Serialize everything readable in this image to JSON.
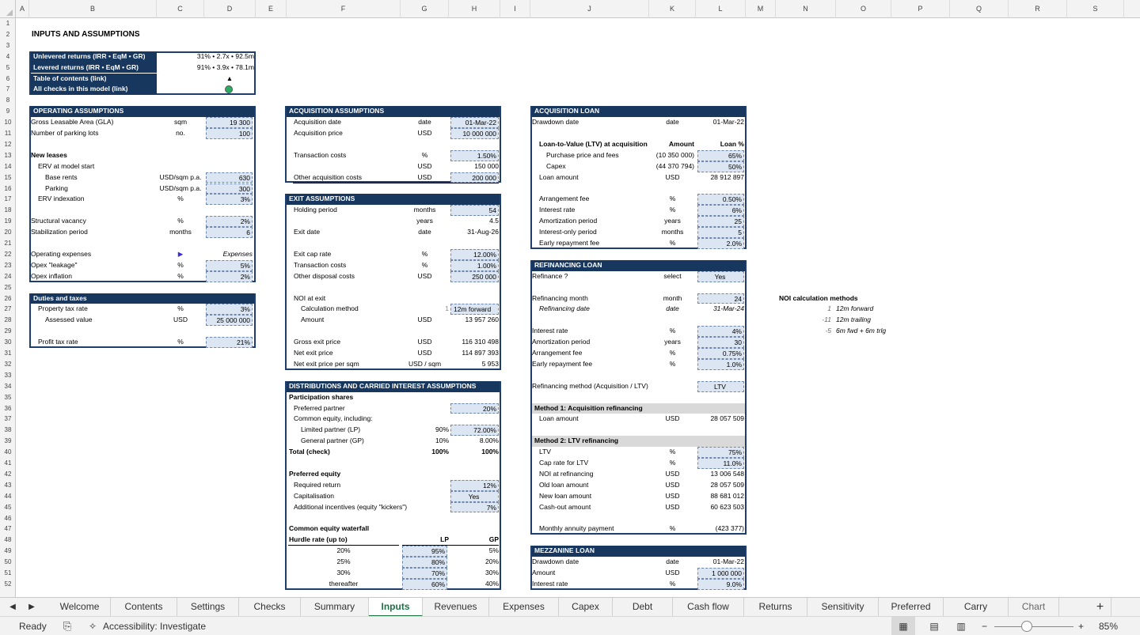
{
  "column_headers": [
    "A",
    "B",
    "C",
    "D",
    "E",
    "F",
    "G",
    "H",
    "I",
    "J",
    "K",
    "L",
    "M",
    "N",
    "O",
    "P",
    "Q",
    "R",
    "S"
  ],
  "row_numbers": [
    "1",
    "2",
    "3",
    "4",
    "5",
    "6",
    "7",
    "8",
    "9",
    "10",
    "11",
    "12",
    "13",
    "14",
    "15",
    "16",
    "17",
    "18",
    "19",
    "20",
    "21",
    "22",
    "23",
    "24",
    "25",
    "26",
    "27",
    "28",
    "29",
    "30",
    "31",
    "32",
    "33",
    "34",
    "35",
    "36",
    "37",
    "38",
    "39",
    "40",
    "41",
    "42",
    "43",
    "44",
    "45",
    "46",
    "47",
    "48",
    "49",
    "50",
    "51",
    "52"
  ],
  "icons": {
    "triangle": "▲",
    "menu_arrow": "▶",
    "status_dot_color": "#27ae60",
    "header_fill": "#17375e",
    "input_fill": "#dce6f2",
    "active_tab_color": "#1e7145"
  },
  "title": "INPUTS AND ASSUMPTIONS",
  "summary": {
    "unlev_label": "Unlevered returns (IRR • EqM • GR)",
    "unlev_value": "31% • 2.7x • 92.5m",
    "lev_label": "Levered returns (IRR • EqM • GR)",
    "lev_value": "91% • 3.9x • 78.1m",
    "toc_label": "Table of contents (link)",
    "checks_label": "All checks in this model (link)"
  },
  "operating": {
    "header": "OPERATING ASSUMPTIONS",
    "gla": [
      "Gross Leasable Area (GLA)",
      "sqm",
      "19 300"
    ],
    "parking": [
      "Number of parking lots",
      "no.",
      "100"
    ],
    "new_leases": "New leases",
    "erv_start": "ERV at model start",
    "base_rents": [
      "Base rents",
      "USD/sqm p.a.",
      "630"
    ],
    "parking_rent": [
      "Parking",
      "USD/sqm p.a.",
      "300"
    ],
    "erv_index": [
      "ERV indexation",
      "%",
      "3%"
    ],
    "vacancy": [
      "Structural vacancy",
      "%",
      "2%"
    ],
    "stabilization": [
      "Stabilization period",
      "months",
      "6"
    ],
    "opex": [
      "Operating expenses",
      "Expenses"
    ],
    "leakage": [
      "Opex \"leakage\"",
      "%",
      "5%"
    ],
    "opex_inflation": [
      "Opex inflation",
      "%",
      "2%"
    ]
  },
  "duties": {
    "header": "Duties and taxes",
    "property_tax": [
      "Property tax rate",
      "%",
      "3%"
    ],
    "assessed": [
      "Assessed value",
      "USD",
      "25 000 000"
    ],
    "profit_tax": [
      "Profit tax rate",
      "%",
      "21%"
    ]
  },
  "acquisition": {
    "header": "ACQUISITION ASSUMPTIONS",
    "date": [
      "Acquisition date",
      "date",
      "01-Mar-22"
    ],
    "price": [
      "Acquisition price",
      "USD",
      "10 000 000"
    ],
    "tc_pct": [
      "Transaction costs",
      "%",
      "1.50%"
    ],
    "tc_usd": [
      "USD",
      "150 000"
    ],
    "other": [
      "Other acquisition costs",
      "USD",
      "200 000"
    ]
  },
  "exit": {
    "header": "EXIT ASSUMPTIONS",
    "holding": [
      "Holding period",
      "months",
      "54"
    ],
    "years": [
      "years",
      "4.5"
    ],
    "exit_date": [
      "Exit date",
      "date",
      "31-Aug-26"
    ],
    "cap_rate": [
      "Exit cap rate",
      "%",
      "12.00%"
    ],
    "tc": [
      "Transaction costs",
      "%",
      "1.00%"
    ],
    "disposal": [
      "Other disposal costs",
      "USD",
      "250 000"
    ],
    "noi": "NOI at exit",
    "calc_method": [
      "Calculation method",
      "1",
      "12m forward"
    ],
    "amount": [
      "Amount",
      "USD",
      "13 957 260"
    ],
    "gross": [
      "Gross exit price",
      "USD",
      "116 310 498"
    ],
    "net": [
      "Net exit price",
      "USD",
      "114 897 393"
    ],
    "net_sqm": [
      "Net exit price per sqm",
      "USD / sqm",
      "5 953"
    ]
  },
  "distributions": {
    "header": "DISTRIBUTIONS AND CARRIED INTEREST ASSUMPTIONS",
    "participation": "Participation shares",
    "preferred": [
      "Preferred partner",
      "20%"
    ],
    "common": "Common equity, including:",
    "lp": [
      "Limited partner (LP)",
      "90%",
      "72.00%"
    ],
    "gp": [
      "General partner (GP)",
      "10%",
      "8.00%"
    ],
    "total": [
      "Total (check)",
      "100%",
      "100%"
    ],
    "pref_equity": "Preferred equity",
    "required": [
      "Required return",
      "12%"
    ],
    "capitalisation": [
      "Capitalisation",
      "Yes"
    ],
    "kickers": [
      "Additional incentives (equity \"kickers\")",
      "7%"
    ],
    "waterfall": "Common equity waterfall",
    "hurdle": [
      "Hurdle rate (up to)",
      "LP",
      "GP"
    ],
    "rows": [
      [
        "20%",
        "95%",
        "5%"
      ],
      [
        "25%",
        "80%",
        "20%"
      ],
      [
        "30%",
        "70%",
        "30%"
      ],
      [
        "thereafter",
        "60%",
        "40%"
      ]
    ]
  },
  "acq_loan": {
    "header": "ACQUISITION LOAN",
    "drawdown": [
      "Drawdown date",
      "date",
      "01-Mar-22"
    ],
    "ltv_hdr": [
      "Loan-to-Value (LTV) at acquisition",
      "Amount",
      "Loan %"
    ],
    "purchase": [
      "Purchase price and fees",
      "(10 350 000)",
      "65%"
    ],
    "capex": [
      "Capex",
      "(44 370 794)",
      "50%"
    ],
    "loan_amount": [
      "Loan amount",
      "USD",
      "28 912 897"
    ],
    "arrangement": [
      "Arrangement fee",
      "%",
      "0.50%"
    ],
    "interest": [
      "Interest rate",
      "%",
      "6%"
    ],
    "amortization": [
      "Amortization period",
      "years",
      "25"
    ],
    "io": [
      "Interest-only period",
      "months",
      "5"
    ],
    "early": [
      "Early repayment fee",
      "%",
      "2.0%"
    ]
  },
  "refi": {
    "header": "REFINANCING LOAN",
    "refinance": [
      "Refinance ?",
      "select",
      "Yes"
    ],
    "month": [
      "Refinancing month",
      "month",
      "24"
    ],
    "date": [
      "Refinancing date",
      "date",
      "31-Mar-24"
    ],
    "interest": [
      "Interest rate",
      "%",
      "4%"
    ],
    "amortization": [
      "Amortization period",
      "years",
      "30"
    ],
    "arrangement": [
      "Arrangement fee",
      "%",
      "0.75%"
    ],
    "early": [
      "Early repayment fee",
      "%",
      "1.0%"
    ],
    "method": [
      "Refinancing method (Acquisition / LTV)",
      "LTV"
    ],
    "m1": "Method 1: Acquisition refinancing",
    "m1_loan": [
      "Loan amount",
      "USD",
      "28 057 509"
    ],
    "m2": "Method 2: LTV refinancing",
    "ltv": [
      "LTV",
      "%",
      "75%"
    ],
    "cap": [
      "Cap rate for LTV",
      "%",
      "11.0%"
    ],
    "noi": [
      "NOI at refinancing",
      "USD",
      "13 006 548"
    ],
    "old": [
      "Old loan amount",
      "USD",
      "28 057 509"
    ],
    "new": [
      "New loan amount",
      "USD",
      "88 681 012"
    ],
    "cashout": [
      "Cash-out amount",
      "USD",
      "60 623 503"
    ],
    "annuity": [
      "Monthly annuity payment",
      "%",
      "(423 377)"
    ]
  },
  "mezz": {
    "header": "MEZZANINE LOAN",
    "drawdown": [
      "Drawdown date",
      "date",
      "01-Mar-22"
    ],
    "amount": [
      "Amount",
      "USD",
      "1 000 000"
    ],
    "interest": [
      "Interest rate",
      "%",
      "9.0%"
    ]
  },
  "noi_methods": {
    "title": "NOI calculation methods",
    "rows": [
      [
        "1",
        "12m forward"
      ],
      [
        "-11",
        "12m trailing"
      ],
      [
        "-5",
        "6m fwd + 6m trlg"
      ]
    ]
  },
  "tabs": [
    "Welcome",
    "Contents",
    "Settings",
    "Checks",
    "Summary",
    "Inputs",
    "Revenues",
    "Expenses",
    "Capex",
    "Debt",
    "Cash flow",
    "Returns",
    "Sensitivity",
    "Preferred",
    "Carry",
    "Chart"
  ],
  "active_tab": "Inputs",
  "add_sheet": "+",
  "status": {
    "ready": "Ready",
    "accessibility": "Accessibility: Investigate",
    "zoom": "85%"
  }
}
